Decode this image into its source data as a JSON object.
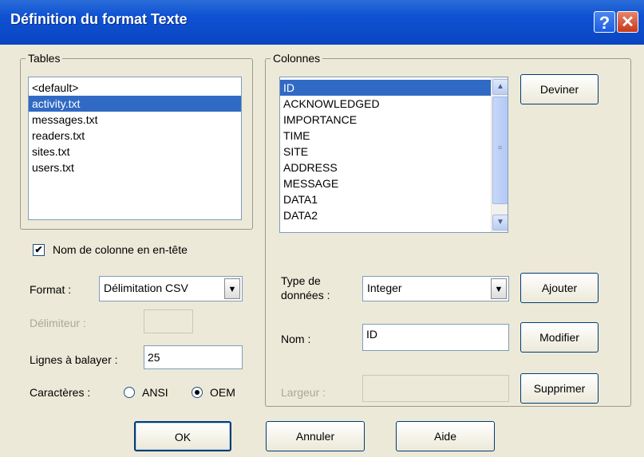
{
  "window": {
    "title": "Définition du format Texte"
  },
  "titlebar": {
    "help_glyph": "?",
    "close_glyph": "✕"
  },
  "tables": {
    "group_label": "Tables",
    "items": [
      "<default>",
      "activity.txt",
      "messages.txt",
      "readers.txt",
      "sites.txt",
      "users.txt"
    ],
    "selected_index": 1
  },
  "header_checkbox": {
    "label": "Nom de colonne en en-tête",
    "checked": true,
    "mark": "✔"
  },
  "format": {
    "label": "Format :",
    "value": "Délimitation CSV"
  },
  "delimiter": {
    "label": "Délimiteur :",
    "value": ""
  },
  "scan_lines": {
    "label": "Lignes à balayer :",
    "value": "25"
  },
  "charset": {
    "label": "Caractères :",
    "options": [
      "ANSI",
      "OEM"
    ],
    "selected": "OEM"
  },
  "columns": {
    "group_label": "Colonnes",
    "items": [
      "ID",
      "ACKNOWLEDGED",
      "IMPORTANCE",
      "TIME",
      "SITE",
      "ADDRESS",
      "MESSAGE",
      "DATA1",
      "DATA2"
    ],
    "selected_index": 0
  },
  "data_type": {
    "label_line1": "Type de",
    "label_line2": "données :",
    "value": "Integer"
  },
  "name_field": {
    "label": "Nom :",
    "value": "ID"
  },
  "width_field": {
    "label": "Largeur :",
    "value": ""
  },
  "buttons": {
    "guess": "Deviner",
    "add": "Ajouter",
    "modify": "Modifier",
    "delete": "Supprimer",
    "ok": "OK",
    "cancel": "Annuler",
    "help": "Aide"
  },
  "colors": {
    "titlebar": "#0a45c2",
    "selection": "#316ac5",
    "dialog_bg": "#ece9d8"
  }
}
